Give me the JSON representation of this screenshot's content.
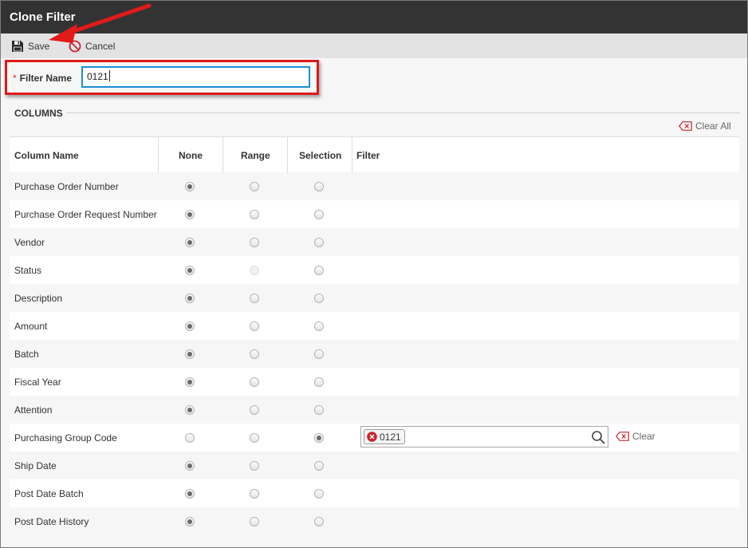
{
  "window": {
    "title": "Clone Filter"
  },
  "toolbar": {
    "save_label": "Save",
    "cancel_label": "Cancel"
  },
  "filter_name": {
    "label": "Filter Name",
    "required_mark": "*",
    "value": "0121"
  },
  "columns_section": {
    "title": "COLUMNS",
    "clear_all_label": "Clear All"
  },
  "grid": {
    "headers": {
      "column_name": "Column Name",
      "none": "None",
      "range": "Range",
      "selection": "Selection",
      "filter": "Filter"
    },
    "rows": [
      {
        "name": "Purchase Order Number",
        "mode": "none",
        "range_disabled": false
      },
      {
        "name": "Purchase Order Request Number",
        "mode": "none",
        "range_disabled": false
      },
      {
        "name": "Vendor",
        "mode": "none",
        "range_disabled": false
      },
      {
        "name": "Status",
        "mode": "none",
        "range_disabled": true
      },
      {
        "name": "Description",
        "mode": "none",
        "range_disabled": false
      },
      {
        "name": "Amount",
        "mode": "none",
        "range_disabled": false
      },
      {
        "name": "Batch",
        "mode": "none",
        "range_disabled": false
      },
      {
        "name": "Fiscal Year",
        "mode": "none",
        "range_disabled": false
      },
      {
        "name": "Attention",
        "mode": "none",
        "range_disabled": false
      },
      {
        "name": "Purchasing Group Code",
        "mode": "selection",
        "range_disabled": false,
        "filter_chip": "0121",
        "clear_label": "Clear"
      },
      {
        "name": "Ship Date",
        "mode": "none",
        "range_disabled": false
      },
      {
        "name": "Post Date Batch",
        "mode": "none",
        "range_disabled": false
      },
      {
        "name": "Post Date History",
        "mode": "none",
        "range_disabled": false
      }
    ]
  },
  "icons": {
    "save": "floppy-disk-icon",
    "cancel": "no-entry-icon",
    "clear": "backspace-x-icon",
    "chip_remove": "x-circle-icon",
    "search": "magnifier-icon"
  },
  "colors": {
    "titlebar": "#333333",
    "toolbar": "#e3e3e3",
    "annotation_red": "#e11a1a",
    "input_focus": "#1a8fd6",
    "chip_remove": "#c8242b"
  }
}
